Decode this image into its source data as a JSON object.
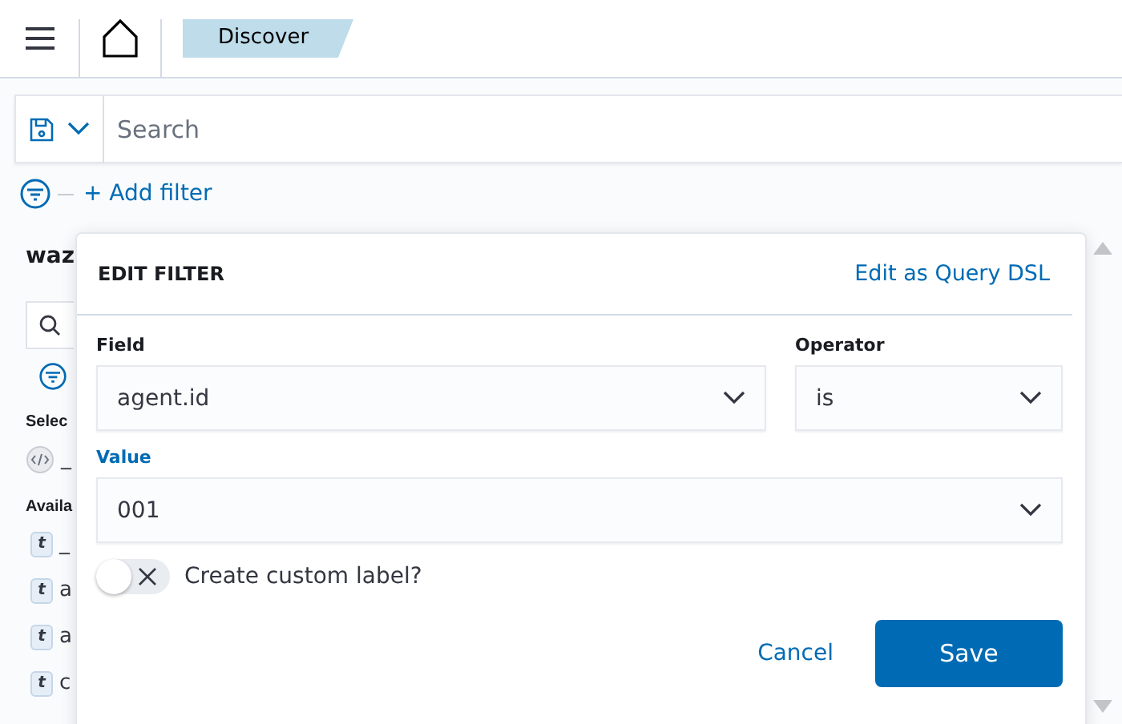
{
  "header": {
    "breadcrumb": "Discover"
  },
  "query_bar": {
    "placeholder": "Search"
  },
  "filter_bar": {
    "add_filter": "+ Add filter"
  },
  "sidebar": {
    "title": "waz",
    "selected_heading": "Selec",
    "selected_fields": [
      {
        "kind": "code",
        "name": "_"
      }
    ],
    "available_heading": "Availa",
    "available_fields": [
      {
        "kind": "typed",
        "type": "t",
        "name": "_"
      },
      {
        "kind": "typed",
        "type": "t",
        "name": "a"
      },
      {
        "kind": "typed",
        "type": "t",
        "name": "a"
      },
      {
        "kind": "typed",
        "type": "t",
        "name": "c"
      }
    ]
  },
  "edit_filter": {
    "title": "EDIT FILTER",
    "dsl_link": "Edit as Query DSL",
    "field": {
      "label": "Field",
      "value": "agent.id"
    },
    "operator": {
      "label": "Operator",
      "value": "is"
    },
    "value": {
      "label": "Value",
      "value": "001",
      "focused": true
    },
    "custom_label": {
      "label": "Create custom label?",
      "on": false
    },
    "buttons": [
      {
        "label": "Cancel",
        "kind": "link"
      },
      {
        "label": "Save",
        "kind": "primary"
      }
    ]
  }
}
